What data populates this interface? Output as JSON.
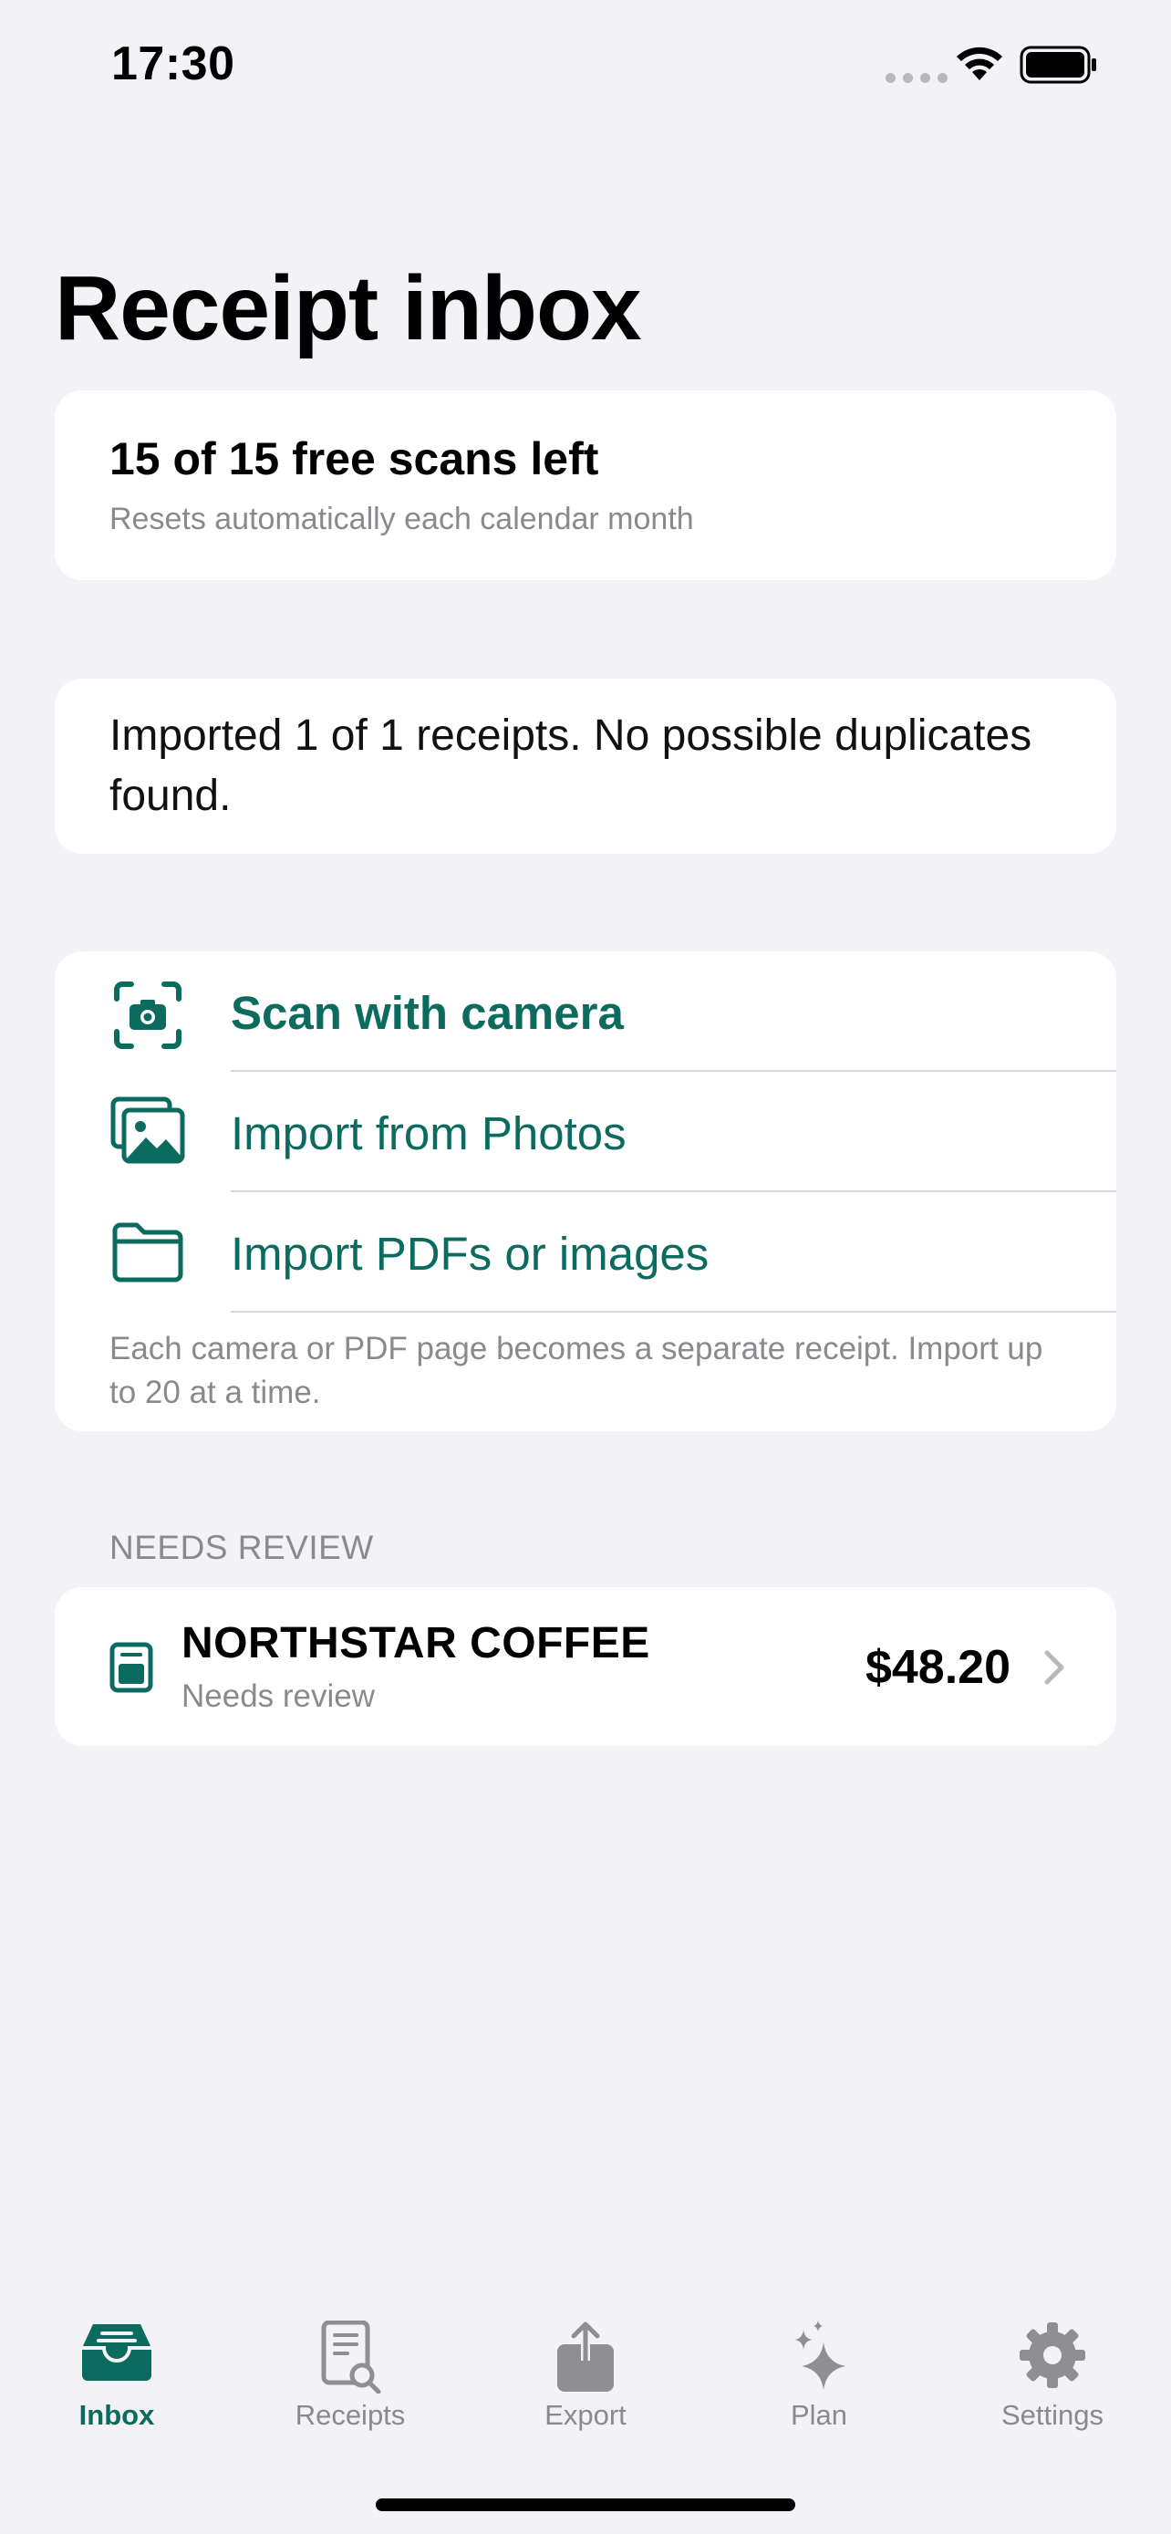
{
  "status_bar": {
    "time": "17:30"
  },
  "page": {
    "title": "Receipt inbox"
  },
  "quota": {
    "title": "15 of 15 free scans left",
    "subtitle": "Resets automatically each calendar month"
  },
  "import_result": {
    "message": "Imported 1 of 1 receipts. No possible duplicates found."
  },
  "actions": {
    "scan_label": "Scan with camera",
    "photos_label": "Import from Photos",
    "files_label": "Import PDFs or images",
    "note": "Each camera or PDF page becomes a separate receipt. Import up to 20 at a time."
  },
  "needs_review": {
    "header": "NEEDS REVIEW",
    "items": [
      {
        "merchant": "NORTHSTAR COFFEE",
        "status": "Needs review",
        "amount": "$48.20"
      }
    ]
  },
  "tab_bar": {
    "tabs": [
      {
        "label": "Inbox",
        "icon": "inbox-tray-icon",
        "active": true
      },
      {
        "label": "Receipts",
        "icon": "receipt-search-icon",
        "active": false
      },
      {
        "label": "Export",
        "icon": "share-export-icon",
        "active": false
      },
      {
        "label": "Plan",
        "icon": "sparkles-icon",
        "active": false
      },
      {
        "label": "Settings",
        "icon": "gear-icon",
        "active": false
      }
    ]
  },
  "colors": {
    "accent": "#0C6B5F",
    "background": "#F2F2F7",
    "secondary_text": "#8A8A8E",
    "inactive_tab": "#8E8E93"
  }
}
